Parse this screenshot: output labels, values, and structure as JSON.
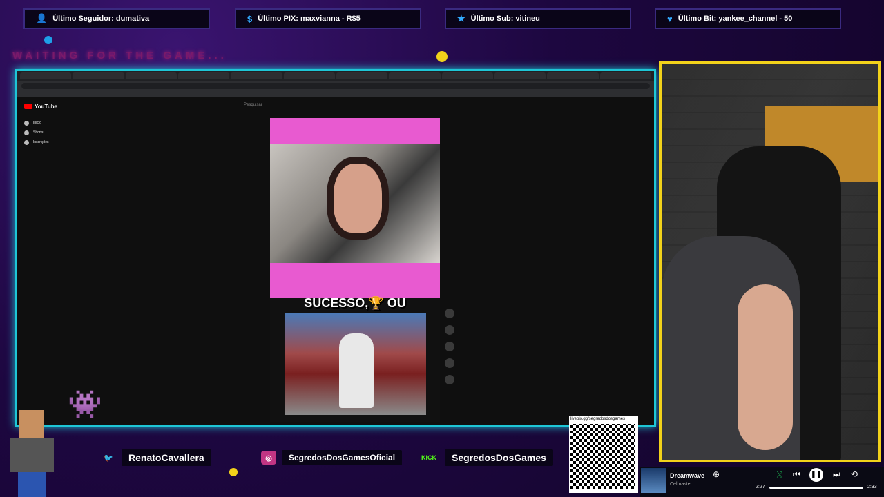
{
  "alerts": [
    {
      "icon": "user-icon",
      "text": "Último Seguidor: dumativa"
    },
    {
      "icon": "dollar-icon",
      "text": "Último PIX: maxvianna - R$5"
    },
    {
      "icon": "star-icon",
      "text": "Último Sub: vitineu"
    },
    {
      "icon": "heart-icon",
      "text": "Último Bit: yankee_channel - 50"
    }
  ],
  "waiting_text": "WAITING FOR THE GAME...",
  "youtube": {
    "logo": "YouTube",
    "search_placeholder": "Pesquisar",
    "caption": "SUCESSO,🏆 OU",
    "sidebar": [
      "Início",
      "Shorts",
      "Inscrições"
    ]
  },
  "social": {
    "twitter": "RenatoCavallera",
    "instagram": "SegredosDosGamesOficial",
    "kick": "SegredosDosGames"
  },
  "qr_url": "livepix.gg/segredosdosgames",
  "player": {
    "song": "Dreamwave",
    "artist": "Celmaster",
    "elapsed": "2:27",
    "total": "2:33",
    "progress": 0.96
  }
}
